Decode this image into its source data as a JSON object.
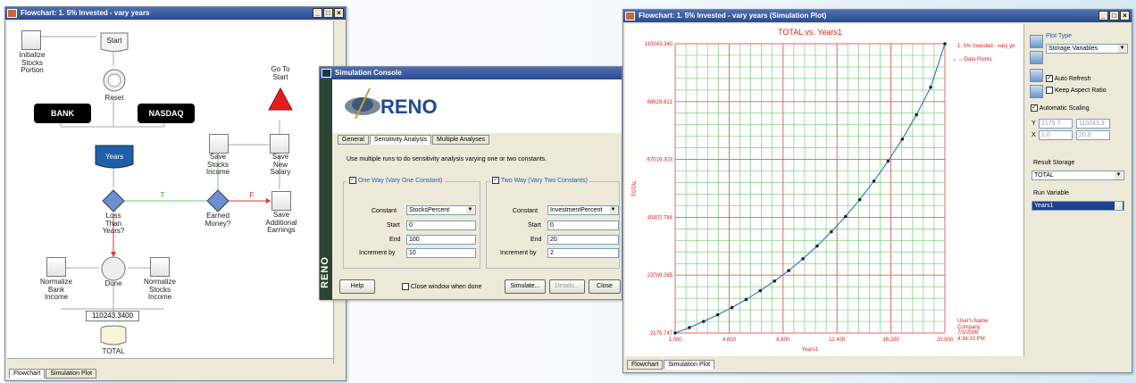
{
  "flowchart_window": {
    "title": "Flowchart: 1. 5% Invested - vary years",
    "tabs": [
      "Flowchart",
      "Simulation Plot"
    ],
    "nodes": {
      "init": "Initialize\nStocks\nPortion",
      "start": "Start",
      "reset": "Reset",
      "goto": "Go To\nStart",
      "bank": "BANK",
      "nasdaq": "NASDAQ",
      "years": "Years",
      "save_stocks": "Save\nStocks\nIncome",
      "save_salary": "Save\nNew\nSalary",
      "loss": "Loss\nThan\nYears?",
      "earned": "Earned\nMoney?",
      "save_additional": "Save\nAdditional\nEarnings",
      "t_label": "T",
      "f_label": "F",
      "normalize_bank": "Normalize\nBank\nIncome",
      "done": "Done",
      "normalize_stocks": "Normalize\nStocks\nIncome",
      "total_value": "110243.3400",
      "total": "TOTAL"
    }
  },
  "console_window": {
    "title": "Simulation Console",
    "logo": "RENO",
    "side_logo": "RENO",
    "tabs": [
      "General",
      "Sensitivity Analysis",
      "Multiple Analyses"
    ],
    "description": "Use multiple runs to do sensitivity analysis varying one or two constants.",
    "one_way": {
      "title": "One Way (Vary One Constant)",
      "constant_label": "Constant",
      "constant_value": "StocksPercent",
      "start_label": "Start",
      "start_value": "0",
      "end_label": "End",
      "end_value": "100",
      "inc_label": "Increment by",
      "inc_value": "10"
    },
    "two_way": {
      "title": "Two Way (Vary Two Constants)",
      "constant_label": "Constant",
      "constant_value": "InvestmentPercent",
      "start_label": "Start",
      "start_value": "0",
      "end_label": "End",
      "end_value": "20",
      "inc_label": "Increment by",
      "inc_value": "2"
    },
    "help": "Help",
    "close_when_done": "Close window when done",
    "simulate": "Simulate...",
    "details": "Details...",
    "close": "Close"
  },
  "plot_window": {
    "title": "Flowchart: 1. 5% Invested - vary years (Simulation Plot)",
    "tabs": [
      "Flowchart",
      "Simulation Plot"
    ],
    "legend_series": "1. 5% Invested - vary ye",
    "legend_points": "Data Points",
    "footer": "User's Name\nCompany\n7/3/2006\n4:38:10 PM",
    "sidebar": {
      "plot_type_label": "Plot Type",
      "plot_type_value": "Storage Variables",
      "auto_refresh": "Auto Refresh",
      "keep_aspect": "Keep Aspect Ratio",
      "auto_scaling": "Automatic Scaling",
      "y_label": "Y",
      "y_min": "2175.7",
      "y_max": "110243.3",
      "x_label": "X",
      "x_min": "1.0",
      "x_max": "20.0",
      "result_storage_label": "Result Storage",
      "result_storage_value": "TOTAL",
      "run_variable_label": "Run Variable",
      "run_variable_value": "Years1"
    }
  },
  "chart_data": {
    "type": "line",
    "title": "TOTAL vs. Years1",
    "xlabel": "Years1",
    "ylabel": "TOTAL",
    "xlim": [
      1.0,
      20.0
    ],
    "ylim": [
      2175.747,
      110243.34
    ],
    "x_ticks": [
      "1.000",
      "4.800",
      "8.600",
      "12.400",
      "16.200",
      "20.000"
    ],
    "y_ticks": [
      "2175.747",
      "23789.265",
      "45402.784",
      "67016.303",
      "88629.821",
      "110243.340"
    ],
    "grid": true,
    "legend_position": "right",
    "series": [
      {
        "name": "1. 5% Invested - vary ye",
        "color": "#3b7fc4",
        "x": [
          1,
          2,
          3,
          4,
          5,
          6,
          7,
          8,
          9,
          10,
          11,
          12,
          13,
          14,
          15,
          16,
          17,
          18,
          19,
          20
        ],
        "y": [
          2175.7,
          4200,
          6500,
          9000,
          11700,
          14700,
          18000,
          21600,
          25500,
          29900,
          34700,
          40000,
          45700,
          52000,
          58900,
          66400,
          74600,
          83700,
          94000,
          110243.3
        ]
      }
    ]
  }
}
